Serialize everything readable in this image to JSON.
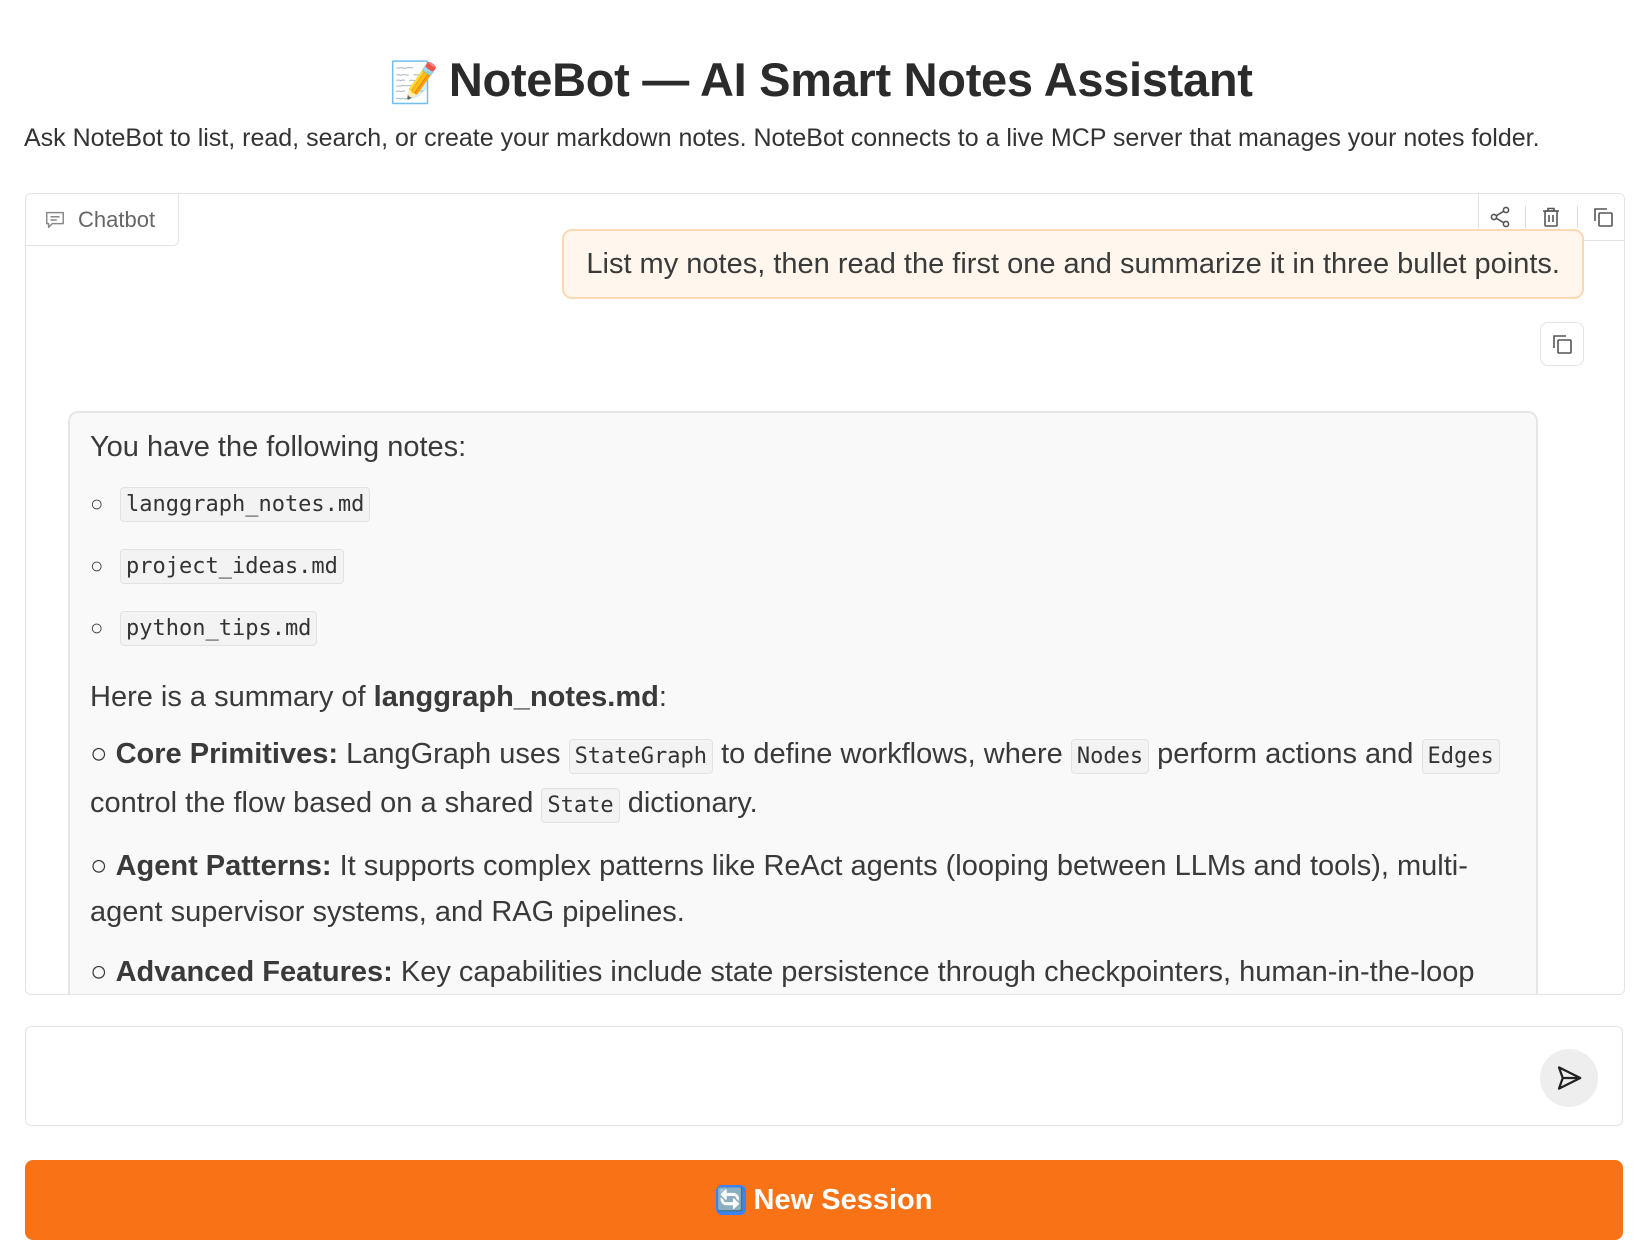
{
  "header": {
    "emoji": "📝",
    "title": "NoteBot — AI Smart Notes Assistant",
    "description": "Ask NoteBot to list, read, search, or create your markdown notes. NoteBot connects to a live MCP server that manages your notes folder."
  },
  "chatbot": {
    "tab_label": "Chatbot",
    "toolbar": [
      "share-icon",
      "trash-icon",
      "copy-icon"
    ],
    "user_message": "List my notes, then read the first one and summarize it in three bullet points.",
    "bot_message": {
      "intro": "You have the following notes:",
      "notes": [
        "langgraph_notes.md",
        "project_ideas.md",
        "python_tips.md"
      ],
      "summary_prefix": "Here is a summary of ",
      "summary_file": "langgraph_notes.md",
      "summary_suffix": ":",
      "bullet": "○",
      "points": [
        {
          "title": "Core Primitives:",
          "t1": " LangGraph uses ",
          "c1": "StateGraph",
          "t2": " to define workflows, where ",
          "c2": "Nodes",
          "t3": " perform actions and ",
          "c3": "Edges",
          "t4": " control the flow based on a shared ",
          "c4": "State",
          "t5": " dictionary."
        },
        {
          "title": "Agent Patterns:",
          "text": " It supports complex patterns like ReAct agents (looping between LLMs and tools), multi-agent supervisor systems, and RAG pipelines."
        },
        {
          "title": "Advanced Features:",
          "text": " Key capabilities include state persistence through checkpointers, human-in-the-loop"
        }
      ]
    }
  },
  "input": {
    "placeholder": ""
  },
  "buttons": {
    "new_session_emoji": "🔄",
    "new_session": "New Session"
  },
  "colors": {
    "accent": "#f97316",
    "user_bubble_bg": "#fff7ed",
    "user_bubble_border": "#fcd9b0",
    "bot_bubble_bg": "#f9f9f9"
  }
}
